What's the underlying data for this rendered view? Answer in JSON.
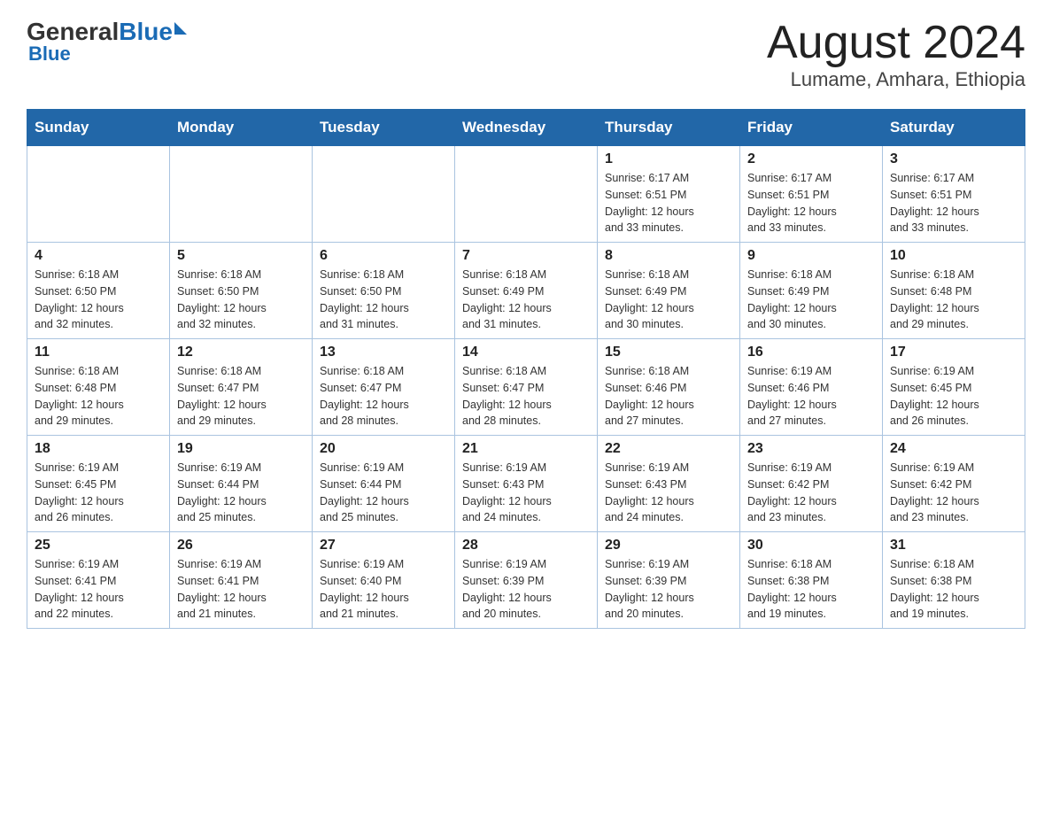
{
  "header": {
    "logo": {
      "general": "General",
      "blue": "Blue",
      "subtitle": "Blue"
    },
    "title": "August 2024",
    "location": "Lumame, Amhara, Ethiopia"
  },
  "days_of_week": [
    "Sunday",
    "Monday",
    "Tuesday",
    "Wednesday",
    "Thursday",
    "Friday",
    "Saturday"
  ],
  "weeks": [
    {
      "days": [
        {
          "number": "",
          "info": ""
        },
        {
          "number": "",
          "info": ""
        },
        {
          "number": "",
          "info": ""
        },
        {
          "number": "",
          "info": ""
        },
        {
          "number": "1",
          "info": "Sunrise: 6:17 AM\nSunset: 6:51 PM\nDaylight: 12 hours\nand 33 minutes."
        },
        {
          "number": "2",
          "info": "Sunrise: 6:17 AM\nSunset: 6:51 PM\nDaylight: 12 hours\nand 33 minutes."
        },
        {
          "number": "3",
          "info": "Sunrise: 6:17 AM\nSunset: 6:51 PM\nDaylight: 12 hours\nand 33 minutes."
        }
      ]
    },
    {
      "days": [
        {
          "number": "4",
          "info": "Sunrise: 6:18 AM\nSunset: 6:50 PM\nDaylight: 12 hours\nand 32 minutes."
        },
        {
          "number": "5",
          "info": "Sunrise: 6:18 AM\nSunset: 6:50 PM\nDaylight: 12 hours\nand 32 minutes."
        },
        {
          "number": "6",
          "info": "Sunrise: 6:18 AM\nSunset: 6:50 PM\nDaylight: 12 hours\nand 31 minutes."
        },
        {
          "number": "7",
          "info": "Sunrise: 6:18 AM\nSunset: 6:49 PM\nDaylight: 12 hours\nand 31 minutes."
        },
        {
          "number": "8",
          "info": "Sunrise: 6:18 AM\nSunset: 6:49 PM\nDaylight: 12 hours\nand 30 minutes."
        },
        {
          "number": "9",
          "info": "Sunrise: 6:18 AM\nSunset: 6:49 PM\nDaylight: 12 hours\nand 30 minutes."
        },
        {
          "number": "10",
          "info": "Sunrise: 6:18 AM\nSunset: 6:48 PM\nDaylight: 12 hours\nand 29 minutes."
        }
      ]
    },
    {
      "days": [
        {
          "number": "11",
          "info": "Sunrise: 6:18 AM\nSunset: 6:48 PM\nDaylight: 12 hours\nand 29 minutes."
        },
        {
          "number": "12",
          "info": "Sunrise: 6:18 AM\nSunset: 6:47 PM\nDaylight: 12 hours\nand 29 minutes."
        },
        {
          "number": "13",
          "info": "Sunrise: 6:18 AM\nSunset: 6:47 PM\nDaylight: 12 hours\nand 28 minutes."
        },
        {
          "number": "14",
          "info": "Sunrise: 6:18 AM\nSunset: 6:47 PM\nDaylight: 12 hours\nand 28 minutes."
        },
        {
          "number": "15",
          "info": "Sunrise: 6:18 AM\nSunset: 6:46 PM\nDaylight: 12 hours\nand 27 minutes."
        },
        {
          "number": "16",
          "info": "Sunrise: 6:19 AM\nSunset: 6:46 PM\nDaylight: 12 hours\nand 27 minutes."
        },
        {
          "number": "17",
          "info": "Sunrise: 6:19 AM\nSunset: 6:45 PM\nDaylight: 12 hours\nand 26 minutes."
        }
      ]
    },
    {
      "days": [
        {
          "number": "18",
          "info": "Sunrise: 6:19 AM\nSunset: 6:45 PM\nDaylight: 12 hours\nand 26 minutes."
        },
        {
          "number": "19",
          "info": "Sunrise: 6:19 AM\nSunset: 6:44 PM\nDaylight: 12 hours\nand 25 minutes."
        },
        {
          "number": "20",
          "info": "Sunrise: 6:19 AM\nSunset: 6:44 PM\nDaylight: 12 hours\nand 25 minutes."
        },
        {
          "number": "21",
          "info": "Sunrise: 6:19 AM\nSunset: 6:43 PM\nDaylight: 12 hours\nand 24 minutes."
        },
        {
          "number": "22",
          "info": "Sunrise: 6:19 AM\nSunset: 6:43 PM\nDaylight: 12 hours\nand 24 minutes."
        },
        {
          "number": "23",
          "info": "Sunrise: 6:19 AM\nSunset: 6:42 PM\nDaylight: 12 hours\nand 23 minutes."
        },
        {
          "number": "24",
          "info": "Sunrise: 6:19 AM\nSunset: 6:42 PM\nDaylight: 12 hours\nand 23 minutes."
        }
      ]
    },
    {
      "days": [
        {
          "number": "25",
          "info": "Sunrise: 6:19 AM\nSunset: 6:41 PM\nDaylight: 12 hours\nand 22 minutes."
        },
        {
          "number": "26",
          "info": "Sunrise: 6:19 AM\nSunset: 6:41 PM\nDaylight: 12 hours\nand 21 minutes."
        },
        {
          "number": "27",
          "info": "Sunrise: 6:19 AM\nSunset: 6:40 PM\nDaylight: 12 hours\nand 21 minutes."
        },
        {
          "number": "28",
          "info": "Sunrise: 6:19 AM\nSunset: 6:39 PM\nDaylight: 12 hours\nand 20 minutes."
        },
        {
          "number": "29",
          "info": "Sunrise: 6:19 AM\nSunset: 6:39 PM\nDaylight: 12 hours\nand 20 minutes."
        },
        {
          "number": "30",
          "info": "Sunrise: 6:18 AM\nSunset: 6:38 PM\nDaylight: 12 hours\nand 19 minutes."
        },
        {
          "number": "31",
          "info": "Sunrise: 6:18 AM\nSunset: 6:38 PM\nDaylight: 12 hours\nand 19 minutes."
        }
      ]
    }
  ]
}
